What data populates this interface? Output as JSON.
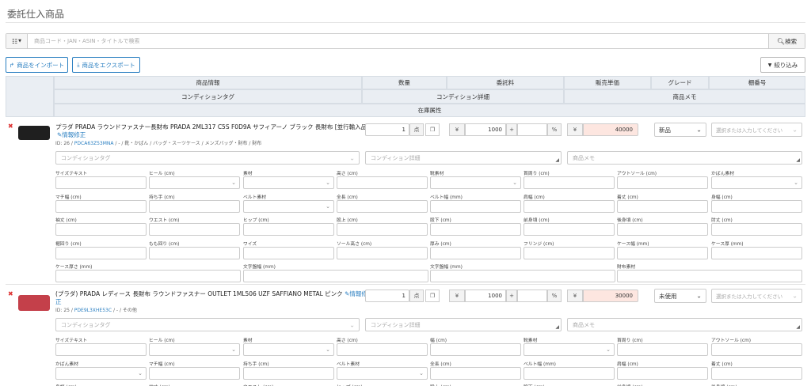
{
  "page": {
    "title": "委託仕入商品"
  },
  "search": {
    "placeholder": "商品コード・JAN・ASIN・タイトルで検索",
    "button": "検索"
  },
  "toolbar": {
    "import": "商品をインポート",
    "export": "商品をエクスポート",
    "filter": "絞り込み"
  },
  "headers": {
    "product_info": "商品情報",
    "quantity": "数量",
    "commission": "委託料",
    "unit_price": "販売単価",
    "grade": "グレード",
    "shelf": "棚番号",
    "condition_tag": "コンディションタグ",
    "condition_detail": "コンディション詳細",
    "product_memo": "商品メモ",
    "stock_attr": "在庫属性"
  },
  "placeholders": {
    "condition_tag": "コンディションタグ",
    "condition_detail": "コンディション詳細",
    "memo": "商品メモ",
    "shelf": "選択または入力してください"
  },
  "units": {
    "pieces": "点",
    "yen": "¥",
    "plus": "+",
    "percent": "%"
  },
  "edit_label": "情報修正",
  "products": [
    {
      "title": "プラダ PRADA ラウンドファスナー長財布 PRADA 2ML317 C5S F0D9A サフィアーノ ブラック 長財布 [並行輸入品]",
      "id_prefix": "ID: 26 / ",
      "code": "PDCA63Z53MNA",
      "category": " / - / 靴・かばん / バッグ・スーツケース / メンズバッグ・財布 / 財布",
      "quantity": "1",
      "commission_amount": "1000",
      "commission_percent": "",
      "price": "40000",
      "grade": "新品",
      "wallet_color": "#1f1f1f",
      "attrs": [
        "サイズテキスト",
        "ヒール (cm)",
        "素材",
        "高さ (cm)",
        "靴素材",
        "首周り (cm)",
        "アウトソール (cm)",
        "かばん素材",
        "マチ幅 (cm)",
        "持ち手 (cm)",
        "ベルト素材",
        "全長 (cm)",
        "ベルト幅 (mm)",
        "肩幅 (cm)",
        "着丈 (cm)",
        "身幅 (cm)",
        "袖丈 (cm)",
        "ウエスト (cm)",
        "ヒップ (cm)",
        "股上 (cm)",
        "股下 (cm)",
        "前身頃 (cm)",
        "後身頃 (cm)",
        "肘丈 (cm)",
        "裾回り (cm)",
        "もも回り (cm)",
        "ワイズ",
        "ソール高さ (cm)",
        "厚み (cm)",
        "フリンジ (cm)",
        "ケース幅 (mm)",
        "ケース厚 (mm)",
        "ケース厚さ (mm)",
        "文字盤幅 (mm)",
        "文字盤幅 (mm)",
        "財布素材"
      ]
    },
    {
      "title": "(プラダ) PRADA レディース 長財布 ラウンドファスナー OUTLET 1ML506 UZF SAFFIANO METAL ピンク",
      "title2": "正",
      "id_prefix": "ID: 25 / ",
      "code": "PDE9L3XHE53C",
      "category": " / - / その他",
      "quantity": "1",
      "commission_amount": "1000",
      "commission_percent": "",
      "price": "30000",
      "grade": "未使用",
      "wallet_color": "#c4404a",
      "attrs": [
        "サイズテキスト",
        "ヒール (cm)",
        "素材",
        "高さ (cm)",
        "幅 (cm)",
        "靴素材",
        "首周り (cm)",
        "アウトソール (cm)",
        "かばん素材",
        "マチ幅 (cm)",
        "持ち手 (cm)",
        "ベルト素材",
        "全長 (cm)",
        "ベルト幅 (mm)",
        "肩幅 (cm)",
        "着丈 (cm)",
        "身幅 (cm)",
        "袖丈 (cm)",
        "ウエスト (cm)",
        "ヒップ (cm)",
        "股上 (cm)",
        "股下 (cm)",
        "前身頃 (cm)",
        "後身頃 (cm)"
      ]
    }
  ]
}
